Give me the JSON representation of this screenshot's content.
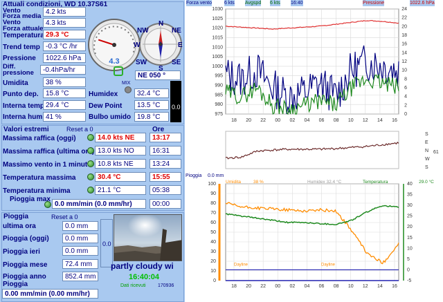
{
  "title": "Attuali condizioni, WD 10.37S61",
  "current": {
    "rows": [
      {
        "label": "Vento",
        "value": "4.2 kts"
      },
      {
        "label": "Forza media\nVento",
        "value": "4.3 kts"
      },
      {
        "label": "Forza attuale",
        "value": ""
      },
      {
        "label": "Temperatura",
        "value": "29.3 °C"
      },
      {
        "label": "Trend temp",
        "value": "-0.3 °C /hr"
      },
      {
        "label": "Pressione",
        "value": "1022.6 hPa"
      },
      {
        "label": "Diff.\npressione",
        "value": "-0.4hPa/hr"
      },
      {
        "label": "Umidita",
        "value": "38 %"
      },
      {
        "label": "Punto dep.",
        "value": "15.8 °C"
      },
      {
        "label": "Interna temp.",
        "value": "29.4 °C"
      },
      {
        "label": "Interna hum",
        "value": "41 %"
      }
    ],
    "humidex_label": "Humidex",
    "humidex": "32.4 °C",
    "dewpoint_label": "Dew Point",
    "dewpoint": "13.5 °C",
    "wetbulb_label": "Bulbo umido",
    "wetbulb": "19.8 °C",
    "max_label": "MIX",
    "side_value": "0.0"
  },
  "gauges": {
    "speed": "4.3",
    "speed_level_fraction": 0.1,
    "compass": {
      "n": "N",
      "ne": "NE",
      "e": "E",
      "se": "SE",
      "s": "S",
      "sw": "SW",
      "w": "W",
      "nw": "NW"
    },
    "direction": "NE  050 °"
  },
  "extremes": {
    "title": "Valori estremi",
    "reset": "Reset a 0",
    "time_header": "Ore",
    "rows": [
      {
        "label": "Massima raffica (oggi)",
        "value": "14.0 kts  NE",
        "time": "13:17",
        "highlight": true
      },
      {
        "label": "Massima raffica (ultima ora)",
        "value": "13.0 kts  NO",
        "time": "16:31",
        "highlight": false
      },
      {
        "label": "Massimo vento in 1 minuto",
        "value": "10.8 kts  NE",
        "time": "13:24",
        "highlight": false
      },
      {
        "label": "Temperatura massima",
        "value": "30.4 °C",
        "time": "15:55",
        "highlight": true
      },
      {
        "label": "Temperatura minima",
        "value": "21.1 °C",
        "time": "05:38",
        "highlight": false
      }
    ],
    "rain_max_label": "Pioggia max",
    "rain_max_value": "0.0 mm/min (0.0 mm/hr)",
    "rain_max_time": "00:00"
  },
  "rain": {
    "title": "Pioggia",
    "reset": "Reset a 0",
    "rows": [
      {
        "label": "ultima ora",
        "value": "0.0 mm"
      },
      {
        "label": "Pioggia (oggi)",
        "value": "0.0 mm"
      },
      {
        "label": "Pioggia ieri",
        "value": "0.0 mm"
      },
      {
        "label": "Pioggia mese",
        "value": "72.4 mm"
      },
      {
        "label": "Pioggia anno",
        "value": "852.4 mm"
      }
    ],
    "rate_label": "Pioggia",
    "rate_value": "0.00 mm/min (0.00 mm/hr)",
    "side_value": "0.0"
  },
  "camera": {
    "condition": "partly cloudy wi",
    "time": "16:40:04",
    "status": "Dati ricevuti",
    "counter": "170936"
  },
  "top_chart": {
    "legend": [
      {
        "text": "Forza vento",
        "color": "#000080"
      },
      {
        "text": "6 kts",
        "color": "#000080"
      },
      {
        "text": "Avgspd",
        "color": "#006600"
      },
      {
        "text": "6 kts",
        "color": "#006600"
      },
      {
        "text": "16:40",
        "color": "#000080"
      },
      {
        "text": "Pressione",
        "color": "#cc0000"
      },
      {
        "text": "1022.6 hPa",
        "color": "#cc0000"
      }
    ]
  },
  "mid_chart": {
    "dirs": [
      "S",
      "E",
      "N",
      "W",
      "S"
    ],
    "value": "61"
  },
  "bottom_chart": {
    "rain_label": "Pioggia",
    "rain_value": "0.0 mm",
    "umid_label": "Umidita",
    "umid_value": "38 %",
    "humidex_text": "Humidex   32.4 °C",
    "temp_label": "Temperatura",
    "temp_value": "29.0 °C",
    "dayline_labels": [
      "Dayline",
      "Dayline"
    ]
  },
  "x_ticks": [
    "18",
    "20",
    "22",
    "00",
    "02",
    "04",
    "06",
    "08",
    "10",
    "12",
    "14",
    "16"
  ],
  "chart_data": [
    {
      "type": "line",
      "title": "",
      "x": [
        "18",
        "20",
        "22",
        "00",
        "02",
        "04",
        "06",
        "08",
        "10",
        "12",
        "14",
        "16"
      ],
      "ylim_left": [
        975,
        1030
      ],
      "ylim_right": [
        0,
        24
      ],
      "series": [
        {
          "name": "Pressione",
          "axis": "left",
          "values": [
            1021,
            1020.5,
            1020,
            1019.5,
            1020,
            1020.5,
            1021,
            1022,
            1023,
            1024,
            1023.5,
            1022.6
          ]
        },
        {
          "name": "Forza vento",
          "axis": "right",
          "values": [
            9,
            8,
            10,
            6,
            4,
            5,
            7,
            4,
            10,
            12,
            11,
            10
          ]
        },
        {
          "name": "Avgspd",
          "axis": "right",
          "values": [
            5,
            4,
            6,
            2,
            1,
            2,
            3,
            2,
            6,
            8,
            7,
            6
          ]
        }
      ],
      "grid": true
    },
    {
      "type": "line",
      "title": "",
      "x": [
        "18",
        "20",
        "22",
        "00",
        "02",
        "04",
        "06",
        "08",
        "10",
        "12",
        "14",
        "16"
      ],
      "series": [
        {
          "name": "",
          "values": [
            0.25,
            0.28,
            0.45,
            0.48,
            0.5,
            0.5,
            0.5,
            0.52,
            0.55,
            0.58,
            0.63,
            0.68
          ]
        }
      ]
    },
    {
      "type": "line",
      "title": "",
      "x": [
        "18",
        "20",
        "22",
        "00",
        "02",
        "04",
        "06",
        "08",
        "10",
        "12",
        "14",
        "16"
      ],
      "ylim_left": [
        0,
        100
      ],
      "ylim_right": [
        -5,
        40
      ],
      "series": [
        {
          "name": "Umidita",
          "axis": "left",
          "values": [
            80,
            76,
            75,
            74,
            73,
            72,
            73,
            72,
            52,
            28,
            18,
            38
          ]
        },
        {
          "name": "Temperatura",
          "axis": "right",
          "values": [
            26,
            25,
            24,
            23,
            22,
            22,
            21.5,
            21.1,
            23,
            27,
            30,
            29
          ]
        },
        {
          "name": "Pioggia",
          "axis": "left",
          "values": [
            0,
            0,
            0,
            0,
            0,
            0,
            0,
            0,
            0,
            0,
            0,
            0
          ]
        }
      ],
      "grid": true
    }
  ]
}
